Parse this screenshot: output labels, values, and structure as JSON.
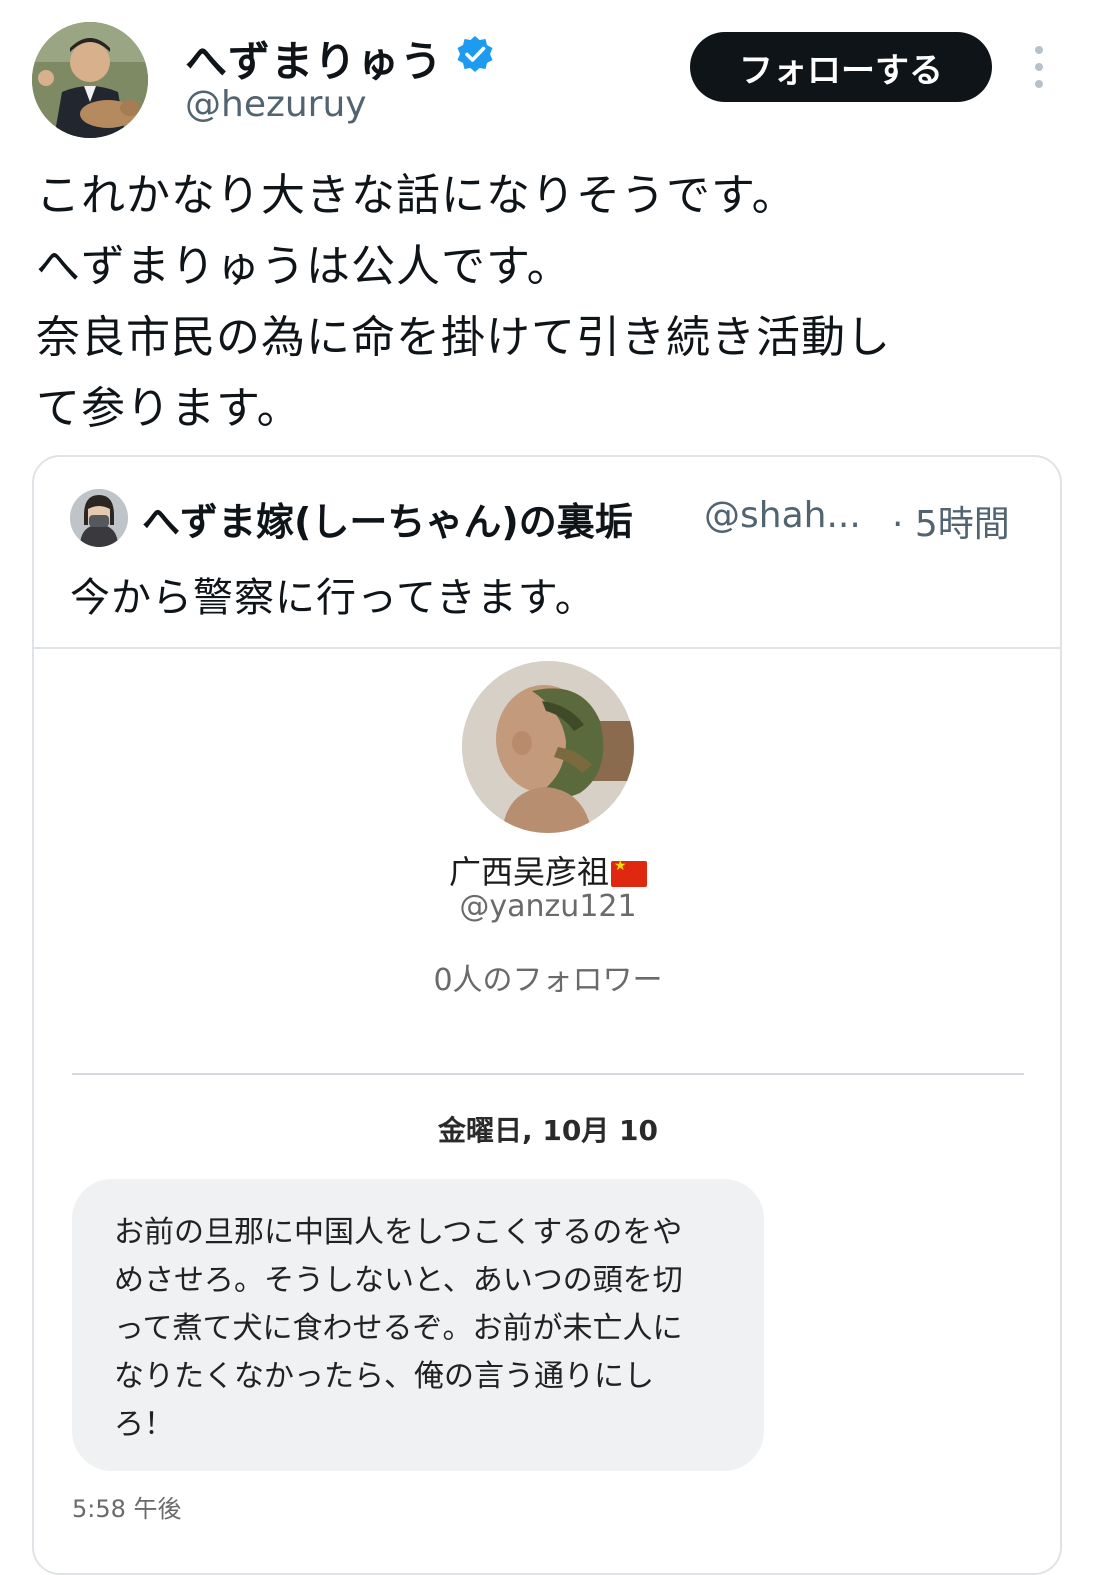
{
  "author": {
    "display_name": "へずまりゅう",
    "handle": "@hezuruy",
    "verified": true,
    "follow_label": "フォローする"
  },
  "tweet": {
    "lines": [
      "これかなり大きな話になりそうです。",
      "へずまりゅうは公人です。",
      "奈良市民の為に命を掛けて引き続き活動し",
      "て参ります。"
    ]
  },
  "quote": {
    "display_name": "へずま嫁(しーちゃん)の裏垢",
    "handle": "@shah...",
    "time": "· 5時間",
    "text": "今から警察に行ってきます。",
    "screenshot": {
      "name": "广西吴彦祖",
      "handle": "@yanzu121",
      "followers": "0人のフォロワー",
      "date": "金曜日, 10月 10",
      "message_lines": [
        "お前の旦那に中国人をしつこくするのをや",
        "めさせろ。そうしないと、あいつの頭を切",
        "って煮て犬に食わせるぞ。お前が未亡人に",
        "なりたくなかったら、俺の言う通りにし",
        "ろ！"
      ],
      "timestamp": "5:58 午後"
    }
  },
  "colors": {
    "verified": "#1d9bf0",
    "follow_bg": "#0f1419",
    "muted": "#536471",
    "border": "#dfe3e7",
    "bubble": "#eff1f3"
  }
}
